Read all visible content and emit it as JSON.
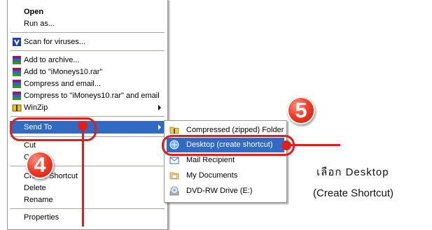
{
  "context_menu": {
    "items": [
      {
        "label": "Open",
        "icon": "none"
      },
      {
        "label": "Run as...",
        "icon": "none"
      },
      {
        "label": "Scan for viruses...",
        "icon": "shield-icon"
      },
      {
        "label": "Add to archive...",
        "icon": "winrar-icon"
      },
      {
        "label": "Add to \"iMoneys10.rar\"",
        "icon": "winrar-icon"
      },
      {
        "label": "Compress and email...",
        "icon": "winrar-icon"
      },
      {
        "label": "Compress to \"iMoneys10.rar\" and email",
        "icon": "winrar-icon"
      },
      {
        "label": "WinZip",
        "icon": "winzip-icon"
      },
      {
        "label": "Send To",
        "icon": "none"
      },
      {
        "label": "Cut",
        "icon": "none"
      },
      {
        "label": "Copy",
        "icon": "none"
      },
      {
        "label": "Create Shortcut",
        "icon": "none"
      },
      {
        "label": "Delete",
        "icon": "none"
      },
      {
        "label": "Rename",
        "icon": "none"
      },
      {
        "label": "Properties",
        "icon": "none"
      }
    ]
  },
  "send_to_menu": {
    "items": [
      {
        "label": "Compressed (zipped) Folder",
        "icon": "zip-folder-icon"
      },
      {
        "label": "Desktop (create shortcut)",
        "icon": "desktop-icon"
      },
      {
        "label": "Mail Recipient",
        "icon": "mail-icon"
      },
      {
        "label": "My Documents",
        "icon": "folder-icon"
      },
      {
        "label": "DVD-RW Drive (E:)",
        "icon": "dvd-drive-icon"
      }
    ]
  },
  "annotations": {
    "step_send_to": "4",
    "step_desktop": "5",
    "instruction_line1": "เลือก  Desktop",
    "instruction_line2": "(Create Shortcut)"
  },
  "colors": {
    "highlight": "#316ac5",
    "annotation_red": "#e11d1d"
  }
}
